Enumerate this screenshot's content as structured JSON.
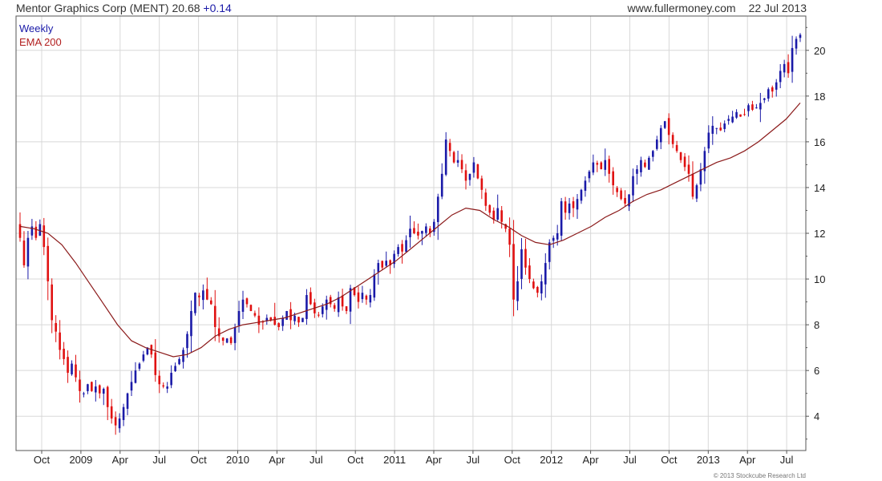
{
  "header": {
    "title": "Mentor Graphics Corp (MENT)",
    "last": "20.68",
    "change": "+0.14",
    "site": "www.fullermoney.com",
    "date": "22 Jul 2013"
  },
  "legend": {
    "series1": "Weekly",
    "series2": "EMA 200"
  },
  "copyright": "© 2013 Stockcube Research Ltd",
  "colors": {
    "up": "#1a1aa8",
    "down": "#e01010",
    "ema": "#8b1a1a",
    "grid": "#d8d8d8",
    "border": "#555555"
  },
  "chart_data": {
    "type": "candlestick",
    "frequency": "weekly",
    "price_axis": {
      "side": "right",
      "ylim": [
        2.5,
        21.5
      ],
      "ticks": [
        4,
        6,
        8,
        10,
        12,
        14,
        16,
        18,
        20
      ]
    },
    "x_labels": [
      "Oct",
      "2009",
      "Apr",
      "Jul",
      "Oct",
      "2010",
      "Apr",
      "Jul",
      "Oct",
      "2011",
      "Apr",
      "Jul",
      "Oct",
      "2012",
      "Apr",
      "Jul",
      "Oct",
      "2013",
      "Apr",
      "Jul"
    ],
    "grid": true,
    "legend_position": "top-left",
    "weekly_closes": [
      11.8,
      10.6,
      11.8,
      12.3,
      11.8,
      12.4,
      11.4,
      9.9,
      8.2,
      7.7,
      6.9,
      6.5,
      5.9,
      6.3,
      5.7,
      5.1,
      5.0,
      5.4,
      5.1,
      5.3,
      5.0,
      5.2,
      4.4,
      3.9,
      3.6,
      3.9,
      4.4,
      5.0,
      5.5,
      6.0,
      6.3,
      6.7,
      7.0,
      6.7,
      5.8,
      5.4,
      5.3,
      5.3,
      5.9,
      6.2,
      6.5,
      6.9,
      7.6,
      8.6,
      9.4,
      9.2,
      9.5,
      9.1,
      8.9,
      7.9,
      7.5,
      7.3,
      7.4,
      7.2,
      7.9,
      8.6,
      9.1,
      8.9,
      8.6,
      8.4,
      8.0,
      8.1,
      8.3,
      8.2,
      8.0,
      7.9,
      8.3,
      8.6,
      8.2,
      8.4,
      8.1,
      8.3,
      9.3,
      8.9,
      8.5,
      8.4,
      8.8,
      9.1,
      8.9,
      8.7,
      9.2,
      8.8,
      8.6,
      9.6,
      9.3,
      9.0,
      9.4,
      9.1,
      9.3,
      10.2,
      10.7,
      10.5,
      10.8,
      10.6,
      11.1,
      11.4,
      11.2,
      11.7,
      12.2,
      12.0,
      11.9,
      12.1,
      12.3,
      12.0,
      12.5,
      13.6,
      14.6,
      16.1,
      15.6,
      15.1,
      15.2,
      14.8,
      14.3,
      14.6,
      15.1,
      14.4,
      13.9,
      13.2,
      12.9,
      12.6,
      13.1,
      12.5,
      12.2,
      11.5,
      9.1,
      9.9,
      11.3,
      10.5,
      10.0,
      9.6,
      9.4,
      9.9,
      10.7,
      11.6,
      11.8,
      12.0,
      13.4,
      12.9,
      13.3,
      13.1,
      13.5,
      13.9,
      14.3,
      14.7,
      15.1,
      15.0,
      14.8,
      15.2,
      14.6,
      14.1,
      13.8,
      13.5,
      13.3,
      13.7,
      14.5,
      14.8,
      15.2,
      14.9,
      15.3,
      15.6,
      16.1,
      16.6,
      16.9,
      16.3,
      15.9,
      15.6,
      15.2,
      14.9,
      14.6,
      13.6,
      14.1,
      14.8,
      15.6,
      16.4,
      16.7,
      16.6,
      16.5,
      16.8,
      17.0,
      17.1,
      17.3,
      17.1,
      17.2,
      17.6,
      17.4,
      17.5,
      17.7,
      17.9,
      18.3,
      18.2,
      18.6,
      19.1,
      19.4,
      19.0,
      20.1,
      20.5,
      20.68
    ],
    "ema_200": [
      12.3,
      12.2,
      12.0,
      11.5,
      10.7,
      9.8,
      8.9,
      8.0,
      7.3,
      7.0,
      6.8,
      6.6,
      6.7,
      7.0,
      7.5,
      7.8,
      8.0,
      8.1,
      8.2,
      8.3,
      8.5,
      8.7,
      8.9,
      9.2,
      9.6,
      10.0,
      10.4,
      10.8,
      11.3,
      11.8,
      12.3,
      12.8,
      13.1,
      13.0,
      12.6,
      12.3,
      11.9,
      11.6,
      11.5,
      11.7,
      12.0,
      12.3,
      12.7,
      13.0,
      13.4,
      13.7,
      13.9,
      14.2,
      14.5,
      14.8,
      15.1,
      15.3,
      15.6,
      16.0,
      16.5,
      17.0,
      17.7
    ]
  }
}
